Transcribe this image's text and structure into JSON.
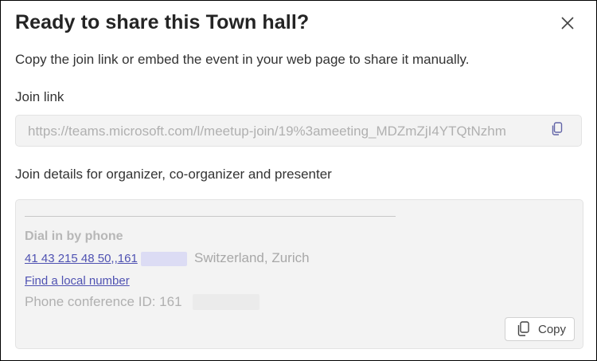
{
  "dialog": {
    "title": "Ready to share this Town hall?",
    "description": "Copy the join link or embed the event in your web page to share it manually.",
    "close_icon": "close-icon"
  },
  "join_link": {
    "label": "Join link",
    "value": "https://teams.microsoft.com/l/meetup-join/19%3ameeting_MDZmZjI4YTQtNzhm",
    "copy_icon": "copy-icon"
  },
  "join_details": {
    "label": "Join details for organizer, co-organizer and presenter",
    "dial_heading": "Dial in by phone",
    "phone_number": "41 43 215 48 50,,161",
    "location": "Switzerland, Zurich",
    "local_number_link": "Find a local number",
    "conference_id": "Phone conference ID: 161",
    "copy_button_label": "Copy",
    "copy_button_icon": "copy-icon"
  },
  "colors": {
    "link": "#4f52b2",
    "field_background": "#f3f3f3",
    "title_text": "#242424"
  }
}
